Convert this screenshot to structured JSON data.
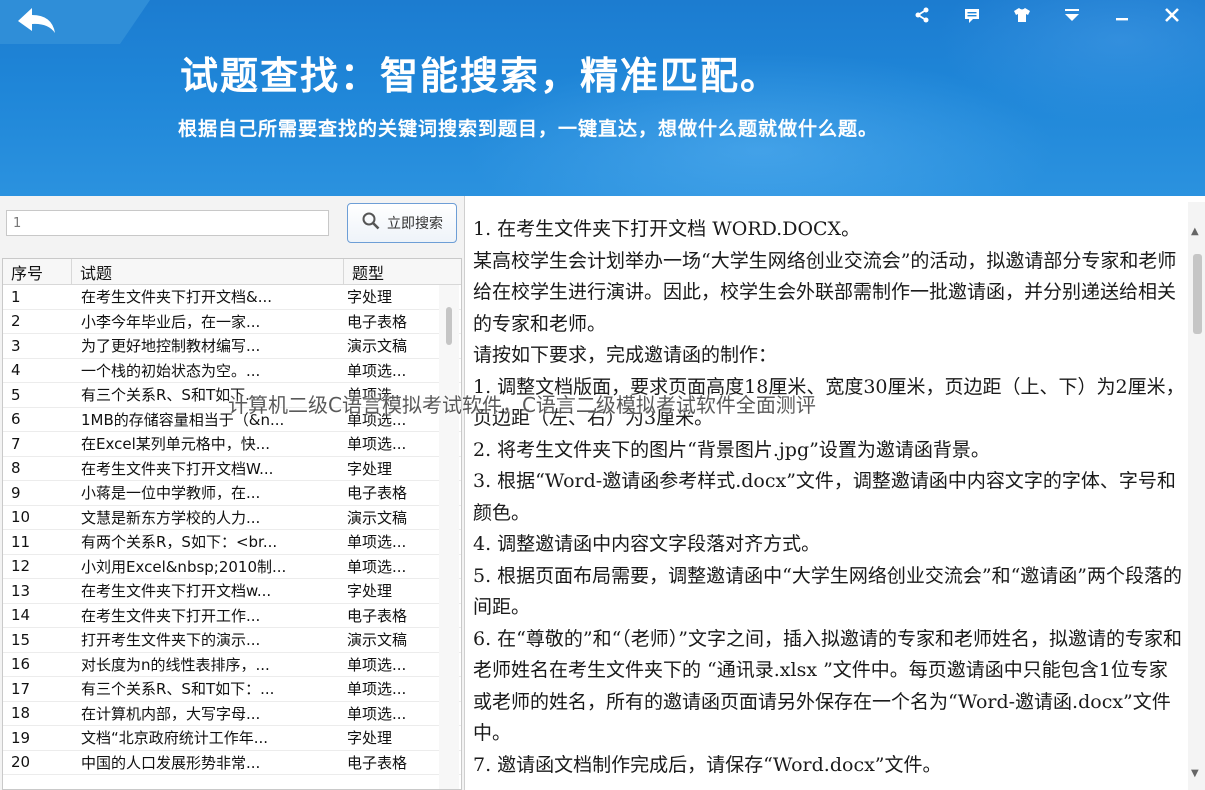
{
  "header": {
    "title": "试题查找：智能搜索，精准匹配。",
    "subtitle": "根据自己所需要查找的关键词搜索到题目，一键直达，想做什么题就做什么题。",
    "icons": [
      "back-icon",
      "share-icon",
      "message-icon",
      "skin-icon",
      "menu-icon",
      "minimize-icon",
      "close-icon"
    ]
  },
  "search": {
    "value": "1",
    "button_label": "立即搜索"
  },
  "table": {
    "columns": [
      "序号",
      "试题",
      "题型"
    ],
    "rows": [
      {
        "no": "1",
        "title": "在考生文件夹下打开文档&...",
        "type": "字处理"
      },
      {
        "no": "2",
        "title": "小李今年毕业后，在一家...",
        "type": "电子表格"
      },
      {
        "no": "3",
        "title": "为了更好地控制教材编写...",
        "type": "演示文稿"
      },
      {
        "no": "4",
        "title": "一个栈的初始状态为空。...",
        "type": "单项选..."
      },
      {
        "no": "5",
        "title": "有三个关系R、S和T如下...",
        "type": "单项选..."
      },
      {
        "no": "6",
        "title": "1MB的存储容量相当于（&n...",
        "type": "单项选..."
      },
      {
        "no": "7",
        "title": "在Excel某列单元格中，快...",
        "type": "单项选..."
      },
      {
        "no": "8",
        "title": "在考生文件夹下打开文档W...",
        "type": "字处理"
      },
      {
        "no": "9",
        "title": "小蒋是一位中学教师，在...",
        "type": "电子表格"
      },
      {
        "no": "10",
        "title": "文慧是新东方学校的人力...",
        "type": "演示文稿"
      },
      {
        "no": "11",
        "title": "有两个关系R，S如下：<br...",
        "type": "单项选..."
      },
      {
        "no": "12",
        "title": "小刘用Excel&nbsp;2010制...",
        "type": "单项选..."
      },
      {
        "no": "13",
        "title": "在考生文件夹下打开文档w...",
        "type": "字处理"
      },
      {
        "no": "14",
        "title": "在考生文件夹下打开工作...",
        "type": "电子表格"
      },
      {
        "no": "15",
        "title": "打开考生文件夹下的演示...",
        "type": "演示文稿"
      },
      {
        "no": "16",
        "title": "对长度为n的线性表排序，...",
        "type": "单项选..."
      },
      {
        "no": "17",
        "title": "有三个关系R、S和T如下：...",
        "type": "单项选..."
      },
      {
        "no": "18",
        "title": "在计算机内部，大写字母...",
        "type": "单项选..."
      },
      {
        "no": "19",
        "title": "文档“北京政府统计工作年...",
        "type": "字处理"
      },
      {
        "no": "20",
        "title": "中国的人口发展形势非常...",
        "type": "电子表格"
      }
    ]
  },
  "question": {
    "paragraphs": [
      "1. 在考生文件夹下打开文档 WORD.DOCX。",
      "某高校学生会计划举办一场“大学生网络创业交流会”的活动，拟邀请部分专家和老师给在校学生进行演讲。因此，校学生会外联部需制作一批邀请函，并分别递送给相关的专家和老师。",
      "请按如下要求，完成邀请函的制作：",
      "1. 调整文档版面，要求页面高度18厘米、宽度30厘米，页边距（上、下）为2厘米，页边距（左、右）为3厘米。",
      "2. 将考生文件夹下的图片“背景图片.jpg”设置为邀请函背景。",
      "3. 根据“Word-邀请函参考样式.docx”文件，调整邀请函中内容文字的字体、字号和颜色。",
      "4. 调整邀请函中内容文字段落对齐方式。",
      "5. 根据页面布局需要，调整邀请函中“大学生网络创业交流会”和“邀请函”两个段落的间距。",
      "6. 在“尊敬的”和“（老师）”文字之间，插入拟邀请的专家和老师姓名，拟邀请的专家和老师姓名在考生文件夹下的 “通讯录.xlsx ”文件中。每页邀请函中只能包含1位专家或老师的姓名，所有的邀请函页面请另外保存在一个名为“Word-邀请函.docx”文件中。",
      "7. 邀请函文档制作完成后，请保存“Word.docx”文件。"
    ]
  },
  "watermark": {
    "text": "计算机二级C语言模拟考试软件，C语言二级模拟考试软件全面测评"
  },
  "colors": {
    "header_blue": "#1f86d8",
    "panel_gray": "#f3f3f3",
    "button_border": "#6d9ed6"
  }
}
